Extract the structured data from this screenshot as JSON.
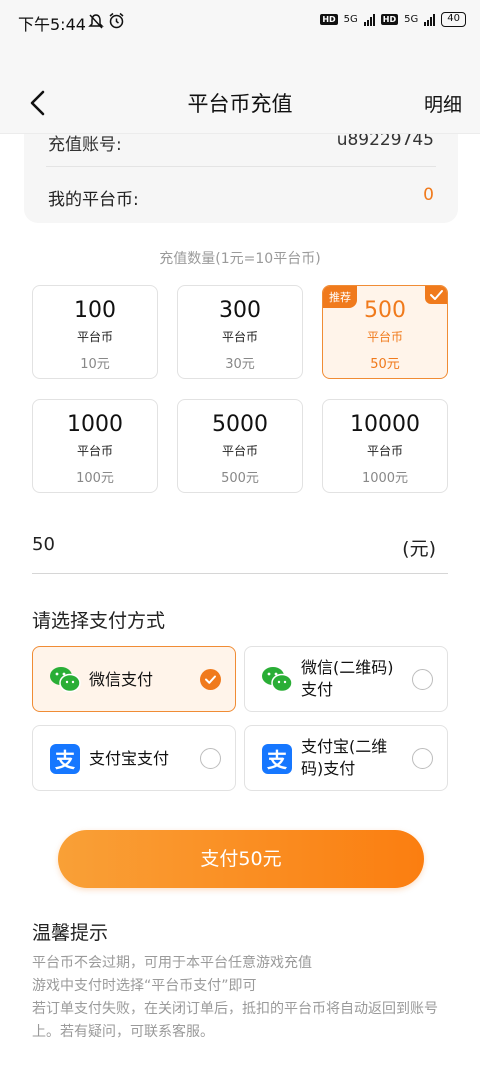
{
  "status_bar": {
    "time": "下午5:44",
    "network1": "5G",
    "network2": "5G",
    "hd1": "HD",
    "hd2": "HD",
    "battery": "40"
  },
  "nav": {
    "title": "平台币充值",
    "detail": "明细"
  },
  "account": {
    "account_label": "充值账号:",
    "account_value": "u89229745",
    "balance_label": "我的平台币:",
    "balance_value": "0"
  },
  "recharge": {
    "hint": "充值数量(1元=10平台币)",
    "recommend_badge": "推荐",
    "packages": [
      {
        "amount": "100",
        "unit": "平台币",
        "price": "10元"
      },
      {
        "amount": "300",
        "unit": "平台币",
        "price": "30元"
      },
      {
        "amount": "500",
        "unit": "平台币",
        "price": "50元"
      },
      {
        "amount": "1000",
        "unit": "平台币",
        "price": "100元"
      },
      {
        "amount": "5000",
        "unit": "平台币",
        "price": "500元"
      },
      {
        "amount": "10000",
        "unit": "平台币",
        "price": "1000元"
      }
    ],
    "selected_index": 2
  },
  "amount_input": {
    "value": "50",
    "unit": "(元)"
  },
  "payment": {
    "title": "请选择支付方式",
    "options": [
      {
        "label": "微信支付",
        "icon": "wechat-icon",
        "selected": true
      },
      {
        "label": "微信(二维码)\n支付",
        "icon": "wechat-icon",
        "selected": false
      },
      {
        "label": "支付宝支付",
        "icon": "alipay-icon",
        "selected": false
      },
      {
        "label": "支付宝(二维\n码)支付",
        "icon": "alipay-icon",
        "selected": false
      }
    ]
  },
  "pay_button": {
    "label": "支付50元"
  },
  "tips": {
    "title": "温馨提示",
    "lines": [
      "平台币不会过期，可用于本平台任意游戏充值",
      "游戏中支付时选择“平台币支付”即可",
      "若订单支付失败，在关闭订单后，抵扣的平台币将自动返回到账号上。若有疑问，可联系客服。"
    ]
  },
  "colors": {
    "accent": "#f07a1c",
    "wechat_green": "#2aae36",
    "alipay_blue": "#1677ff"
  }
}
